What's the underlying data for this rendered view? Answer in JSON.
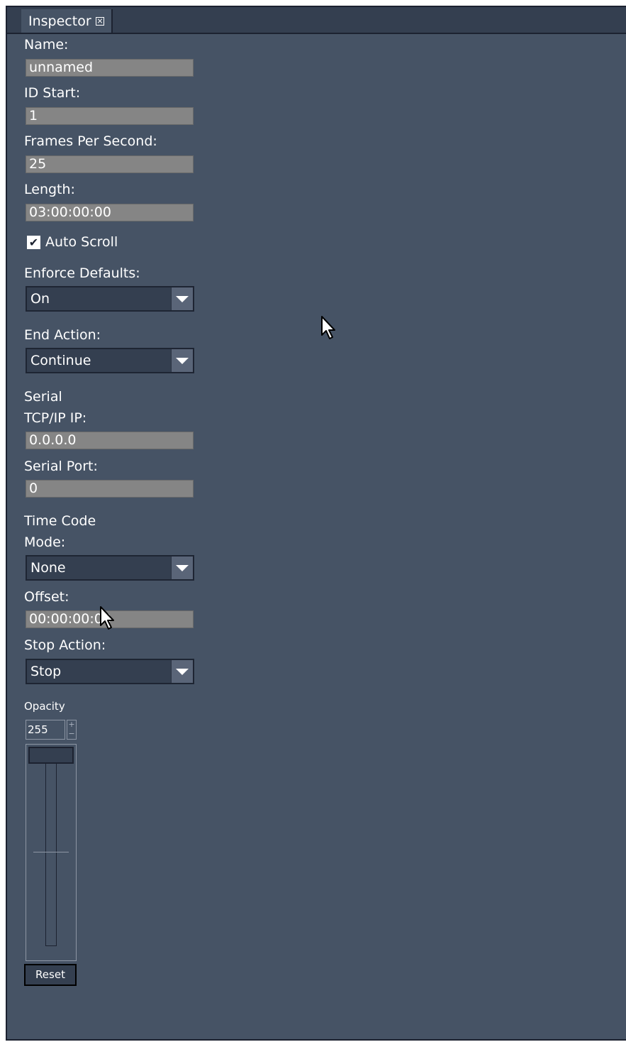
{
  "tab": {
    "title": "Inspector"
  },
  "fields": {
    "name": {
      "label": "Name:",
      "value": "unnamed"
    },
    "id_start": {
      "label": "ID Start:",
      "value": "1"
    },
    "fps": {
      "label": "Frames Per Second:",
      "value": "25"
    },
    "length": {
      "label": "Length:",
      "value": "03:00:00:00"
    }
  },
  "auto_scroll": {
    "label": "Auto Scroll",
    "checked": true
  },
  "enforce_defaults": {
    "label": "Enforce Defaults:",
    "value": "On"
  },
  "end_action": {
    "label": "End Action:",
    "value": "Continue"
  },
  "serial": {
    "heading": "Serial",
    "ip_label": "TCP/IP IP:",
    "ip_value": "0.0.0.0",
    "port_label": "Serial Port:",
    "port_value": "0"
  },
  "timecode": {
    "heading": "Time Code",
    "mode_label": "Mode:",
    "mode_value": "None",
    "offset_label": "Offset:",
    "offset_value": "00:00:00:00"
  },
  "stop_action": {
    "label": "Stop Action:",
    "value": "Stop"
  },
  "opacity": {
    "label": "Opacity",
    "value": "255",
    "level": 1.0,
    "spin_up": "+",
    "spin_down": "−",
    "reset_label": "Reset"
  }
}
